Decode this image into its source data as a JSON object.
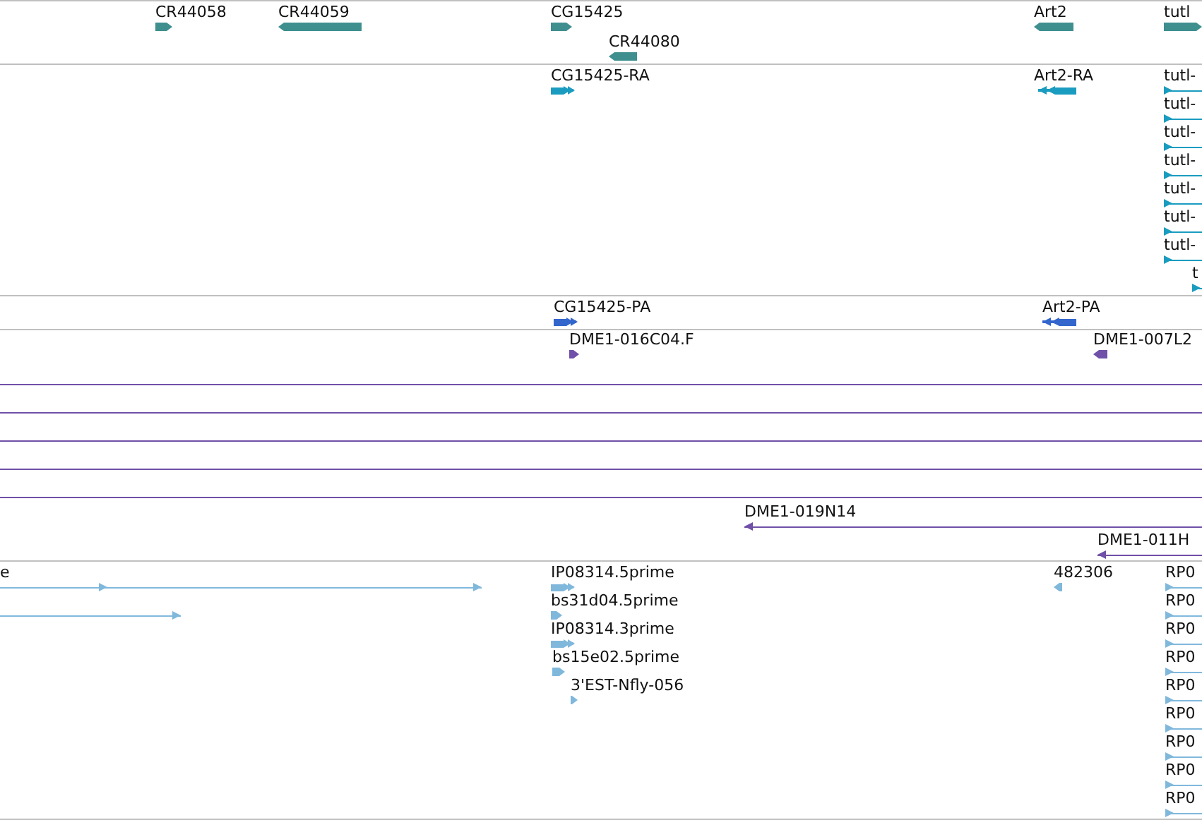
{
  "tracks": [
    {
      "kind": "gene",
      "features": [
        {
          "label": "CR44058",
          "kind": "block",
          "reverse": false
        },
        {
          "label": "CR44059",
          "kind": "block",
          "reverse": true
        },
        {
          "label": "CG15425",
          "kind": "block",
          "reverse": false
        },
        {
          "label": "CR44080",
          "kind": "block",
          "reverse": true
        },
        {
          "label": "Art2",
          "kind": "block",
          "reverse": true
        },
        {
          "label": "tutl",
          "kind": "block",
          "reverse": false
        }
      ]
    },
    {
      "kind": "mrna",
      "features": [
        {
          "label": "CG15425-RA",
          "kind": "exons",
          "reverse": false
        },
        {
          "label": "Art2-RA",
          "kind": "exons",
          "reverse": true
        },
        {
          "label": "tutl-",
          "kind": "line",
          "reverse": false
        },
        {
          "label": "tutl-",
          "kind": "line",
          "reverse": false
        },
        {
          "label": "tutl-",
          "kind": "line",
          "reverse": false
        },
        {
          "label": "tutl-",
          "kind": "line",
          "reverse": false
        },
        {
          "label": "tutl-",
          "kind": "line",
          "reverse": false
        },
        {
          "label": "tutl-",
          "kind": "line",
          "reverse": false
        },
        {
          "label": "tutl-",
          "kind": "line",
          "reverse": false
        },
        {
          "label": "t",
          "kind": "line",
          "reverse": false
        }
      ]
    },
    {
      "kind": "protein",
      "features": [
        {
          "label": "CG15425-PA",
          "kind": "exons",
          "reverse": false
        },
        {
          "label": "Art2-PA",
          "kind": "exons",
          "reverse": true
        }
      ]
    },
    {
      "kind": "clone",
      "features": [
        {
          "label": "DME1-016C04.F",
          "kind": "block",
          "reverse": false
        },
        {
          "label": "DME1-007L2",
          "kind": "block",
          "reverse": true
        },
        {
          "kind": "line"
        },
        {
          "kind": "line"
        },
        {
          "kind": "line"
        },
        {
          "kind": "line"
        },
        {
          "kind": "line"
        },
        {
          "label": "DME1-019N14",
          "kind": "line",
          "reverse": true
        },
        {
          "label": "DME1-011H",
          "kind": "line",
          "reverse": true
        }
      ]
    },
    {
      "kind": "est",
      "features": [
        {
          "label": "e",
          "kind": "line",
          "reverse": false
        },
        {
          "kind": "line",
          "reverse": false
        },
        {
          "label": "IP08314.5prime",
          "kind": "exons",
          "reverse": false
        },
        {
          "label": "bs31d04.5prime",
          "kind": "block",
          "reverse": false
        },
        {
          "label": "IP08314.3prime",
          "kind": "exons",
          "reverse": false
        },
        {
          "label": "bs15e02.5prime",
          "kind": "block",
          "reverse": false
        },
        {
          "label": "3'EST-Nfly-056",
          "kind": "block",
          "reverse": false
        },
        {
          "label": "482306",
          "kind": "block",
          "reverse": true
        },
        {
          "label": "RP0",
          "kind": "line",
          "reverse": false
        },
        {
          "label": "RP0",
          "kind": "line",
          "reverse": false
        },
        {
          "label": "RP0",
          "kind": "line",
          "reverse": false
        },
        {
          "label": "RP0",
          "kind": "line",
          "reverse": false
        },
        {
          "label": "RP0",
          "kind": "line",
          "reverse": false
        },
        {
          "label": "RP0",
          "kind": "line",
          "reverse": false
        },
        {
          "label": "RP0",
          "kind": "line",
          "reverse": false
        },
        {
          "label": "RP0",
          "kind": "line",
          "reverse": false
        },
        {
          "label": "RP0",
          "kind": "line",
          "reverse": false
        }
      ]
    }
  ]
}
